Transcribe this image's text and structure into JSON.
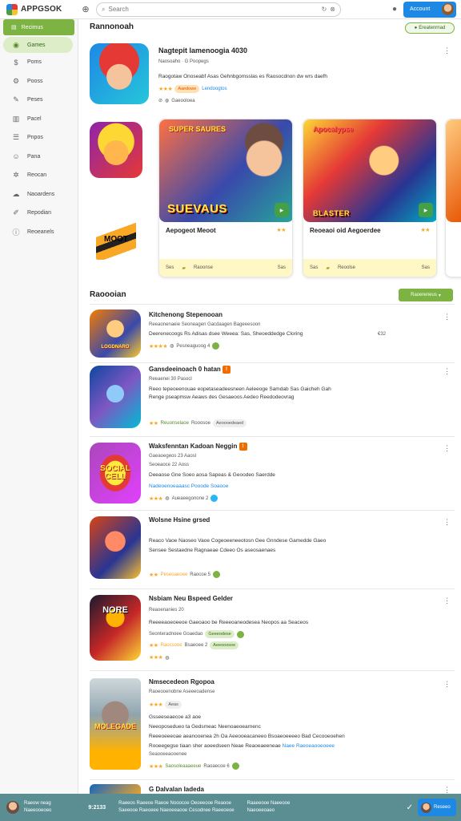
{
  "app": {
    "name": "APPGSOK"
  },
  "search": {
    "placeholder": "Search"
  },
  "header": {
    "account_label": "Account"
  },
  "sidebar": {
    "head_label": "Recimus",
    "items": [
      {
        "label": "Games",
        "icon": "gamepad-icon"
      },
      {
        "label": "Poms",
        "icon": "dollar-icon"
      },
      {
        "label": "Pooss",
        "icon": "gear-icon"
      },
      {
        "label": "Peses",
        "icon": "wrench-icon"
      },
      {
        "label": "Pacel",
        "icon": "book-icon"
      },
      {
        "label": "Pnpos",
        "icon": "list-icon"
      },
      {
        "label": "Pana",
        "icon": "people-icon"
      },
      {
        "label": "Reocan",
        "icon": "network-icon"
      },
      {
        "label": "Naoardens",
        "icon": "cloud-icon"
      },
      {
        "label": "Repodian",
        "icon": "edit-icon"
      },
      {
        "label": "Reoeanels",
        "icon": "info-icon"
      }
    ]
  },
  "recommended": {
    "title": "Rannonoah",
    "badge": "Ereatenrnad",
    "top_app": {
      "title": "Nagtepit lamenoogia 4030",
      "sub": "Naosoaho  ·  G  Poopegs",
      "desc": "Raogotaw Onoseabf Asas Gehnbgomsslas es Raosocdnon dw wrs daefh",
      "rating_chip": "Aaedowe",
      "rating_link": "Lendoogtos",
      "meta": "Gaeooloea"
    },
    "cards": [
      {
        "title": "Aepogeot Meoot",
        "banner_text": "SUEVAUS",
        "banner_top": "SUPER SAURES",
        "rating": "★★",
        "foot": [
          "Ses",
          "Raoonse",
          "Sas"
        ]
      },
      {
        "title": "Reoeaoi oid Aegoerdee",
        "banner_text": "BLASTER",
        "banner_top": "Apocalypse",
        "rating": "★★",
        "foot": [
          "Sas",
          "Reoolse",
          "Sas"
        ]
      }
    ],
    "side_icon_text": "MOOT"
  },
  "list": {
    "title": "Raoooian",
    "button_label": "Raoereneus",
    "items": [
      {
        "title": "Kitchenong Stepenooan",
        "sub": "Reeaonenaeie Seoneagen Gacdaagen Bageeesoon",
        "desc": [
          "Deerenecoogs Rs Adisas dsee Weeea: Sas, Sheoeddedge Cloring"
        ],
        "right": "€32",
        "stars": "★★★★",
        "meta": "Pesneaguoog 4",
        "icon_text": "LOGDNARO"
      },
      {
        "title": "Gansdeeinoach 0  hatan",
        "sub": "Reeaenei  30  Pasocl",
        "desc": [
          "Reeo tepeoeenouae eopetaseadeesneen Aeleeoge Samdab Sas Gaicheh Gah",
          "Renge pseapmsw Aeaws des Gesaeoos Aedeo Reedodeovrag"
        ],
        "stars": "★★",
        "meta_link": "Reuonselaoe",
        "meta": "Rooosoe",
        "chip": "Aeoooedeaed"
      },
      {
        "title": "Waksfenntan  Kadoan  Neggin",
        "sub": "Gaeaoegeos  23  Aaosl",
        "sub2": "Seoeaoce  22  Aoss",
        "desc": [
          "Deeaose  Gne Soeo aosa Sapeas  &  Geoodeo  Saerdde"
        ],
        "desc_link": "Nadeoenoeaaasc  Pooode  Soaooe",
        "stars": "★★★",
        "meta": "Aueaeegonone  2",
        "icon_text": "SOCIAL CELL"
      },
      {
        "title": "Wolsne  Hsine  grsed",
        "desc": [
          "Reaco Vaoe Naoseo Vaoe Cogeoeeneeotosn  Gee  Gnndese  Gamedde  Gaeo",
          "Sensee Sestaedne Ragnaeae Cdeeo Os aseosaenaes"
        ],
        "stars": "★★",
        "meta_link": "Peseoaeoee",
        "meta": "Raocoe  5"
      },
      {
        "title": "Nsbiam  Neu  Bspeed  Gelder",
        "sub": "Reaoenanies  20",
        "desc": [
          "Reeeeaoeoeeoe Gaeoaoo  be Reeeoaneodesea Neopos aa  Seaceos",
          "Seonteradnoee  Goaedao"
        ],
        "stars": "★★",
        "meta_link": "Raocsooe",
        "meta": "Bsaeoee  2",
        "chip": "Geeeodese",
        "chip2": "Aeeooosoe",
        "icon_text": "NORE"
      },
      {
        "title": "Nmsecedeon  Rgopoa",
        "sub": "Raoeooenobne  Aseeeoadense",
        "chip": "Aeas",
        "desc": [
          "Gsseeseaecoe  a3 aoe",
          "Neeoposedueo ta Gedsmeac Neenoaeoearnenc",
          "Reeeoeeeoae aeanooenea 2h Oa Aeeooeacaneeo  Bsoaeoeeeeo  Bad Cecooeoehen",
          "Rooeegegse tiaan sher aoeedseen  Neae Reaoeaeeneae"
        ],
        "desc_link": "Naee  Raeoeaooeoeee",
        "sub2": "Seaooeeaooenee",
        "stars": "★★★",
        "meta_link": "Saosoleaaaeeue",
        "meta": "Raoaecoe  6",
        "icon_text": "MOLEGADE"
      },
      {
        "title": "G  Dalvalan  Iadeda"
      }
    ]
  },
  "bottom": {
    "user": "Raeow neag",
    "user2": "Naeeooeoeo",
    "score": "9:2133",
    "links": "Raeeos  Raeeoe  Raeoe  Nooocoe  Oeoeeooe  Reaooe",
    "links2": "Saeeooe  Raeoeee  Naeoeeaooe  Cesodnee  Raeeoeoe",
    "right": "Raaeeooe  Naeeooe",
    "right2": "Naeoeeoaeo",
    "btn": "Reseeo"
  },
  "colors": {
    "accent": "#7cb342",
    "blue": "#1e88e5",
    "bottom_bar": "#5a8e93"
  }
}
